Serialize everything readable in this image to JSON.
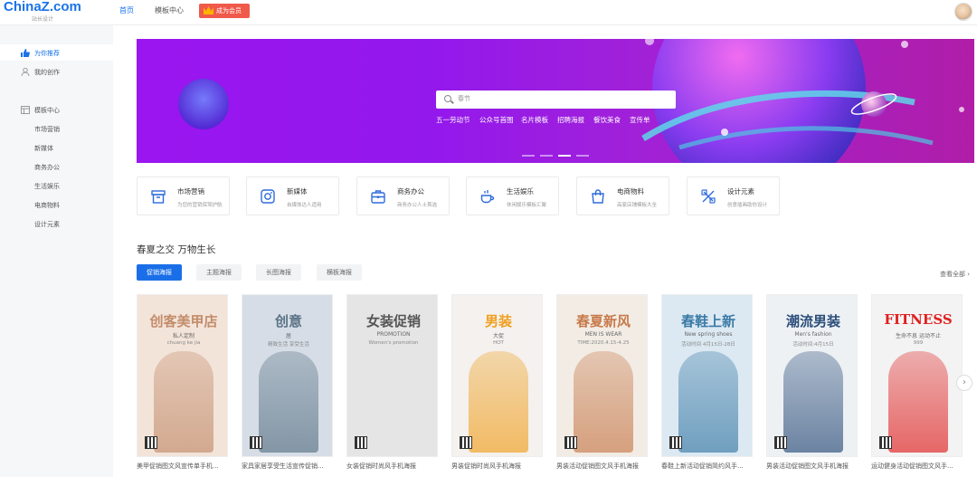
{
  "header": {
    "logo_text": "ChinaZ.com",
    "logo_sub": "站长设计",
    "nav": [
      {
        "label": "首页"
      },
      {
        "label": "模板中心"
      }
    ],
    "vip_label": "成为会员"
  },
  "sidebar": {
    "items": [
      {
        "label": "为你推荐",
        "icon": "thumbs-up-icon"
      },
      {
        "label": "我的创作",
        "icon": "user-icon"
      }
    ],
    "template_center": {
      "label": "模板中心",
      "icon": "template-icon"
    },
    "sub_items": [
      {
        "label": "市场营销"
      },
      {
        "label": "新媒体"
      },
      {
        "label": "商务办公"
      },
      {
        "label": "生活娱乐"
      },
      {
        "label": "电商物料"
      },
      {
        "label": "设计元素"
      }
    ]
  },
  "banner": {
    "search_placeholder": "春节",
    "hot_terms": [
      {
        "label": "五一劳动节"
      },
      {
        "label": "公众号首图"
      },
      {
        "label": "名片模板"
      },
      {
        "label": "招聘海报"
      },
      {
        "label": "餐饮美食"
      },
      {
        "label": "宣传单"
      }
    ],
    "slides": 4,
    "active_slide": 2
  },
  "categories": [
    {
      "title": "市场营销",
      "sub": "为您的营销保驾护航",
      "icon": "box-icon"
    },
    {
      "title": "新媒体",
      "sub": "自媒体达人适用",
      "icon": "camera-icon"
    },
    {
      "title": "商务办公",
      "sub": "商务办公人士首选",
      "icon": "briefcase-icon"
    },
    {
      "title": "生活娱乐",
      "sub": "休闲娱乐模板汇聚",
      "icon": "coffee-icon"
    },
    {
      "title": "电商物料",
      "sub": "高家店铺模板大全",
      "icon": "shopping-bag-icon"
    },
    {
      "title": "设计元素",
      "sub": "创意插画助你设计",
      "icon": "design-tools-icon"
    }
  ],
  "section": {
    "title": "春夏之交 万物生长",
    "tabs": [
      {
        "label": "促销海报"
      },
      {
        "label": "主题海报"
      },
      {
        "label": "长图海报"
      },
      {
        "label": "横板海报"
      }
    ],
    "see_all": "查看全部 ›"
  },
  "cards": [
    {
      "title": "美甲促销图文风宣传单手机...",
      "big": "创客美甲店",
      "line1": "私人定制",
      "line2": "chuang ke jia",
      "color": "#f3e4da",
      "accent": "#c28c6a"
    },
    {
      "title": "家具家居享受生活宣传促销...",
      "big": "创意",
      "line1": "居",
      "line2": "精致生活 享受生活",
      "color": "#d6dde6",
      "accent": "#5a7386"
    },
    {
      "title": "女装促销时尚风手机海报",
      "big": "女装促销",
      "line1": "PROMOTION",
      "line2": "Women's promotion",
      "color": "#e5e5e5",
      "accent": "#555"
    },
    {
      "title": "男装促销时尚风手机海报",
      "big": "男装",
      "line1": "大促",
      "line2": "HOT",
      "color": "#f4f1ee",
      "accent": "#f0a020"
    },
    {
      "title": "男装活动促销图文风手机海报",
      "big": "春夏新风",
      "line1": "MEN IS WEAR",
      "line2": "TIME:2020.4.15-4.25",
      "color": "#f2ece5",
      "accent": "#c77a4a"
    },
    {
      "title": "春鞋上新活动促销简约风手...",
      "big": "春鞋上新",
      "line1": "New spring shoes",
      "line2": "活动时间 4月15日-28日",
      "color": "#dce9f2",
      "accent": "#3a7aa6"
    },
    {
      "title": "男装活动促销图文风手机海报",
      "big": "潮流男装",
      "line1": "Men's fashion",
      "line2": "活动时间:4月15日",
      "color": "#eef1f4",
      "accent": "#2a4d7a"
    },
    {
      "title": "运动健身活动促销图文风手...",
      "big": "FITNESS",
      "line1": "生命不息 运动不止",
      "line2": "999",
      "color": "#f3f3f3",
      "accent": "#e02020"
    }
  ]
}
